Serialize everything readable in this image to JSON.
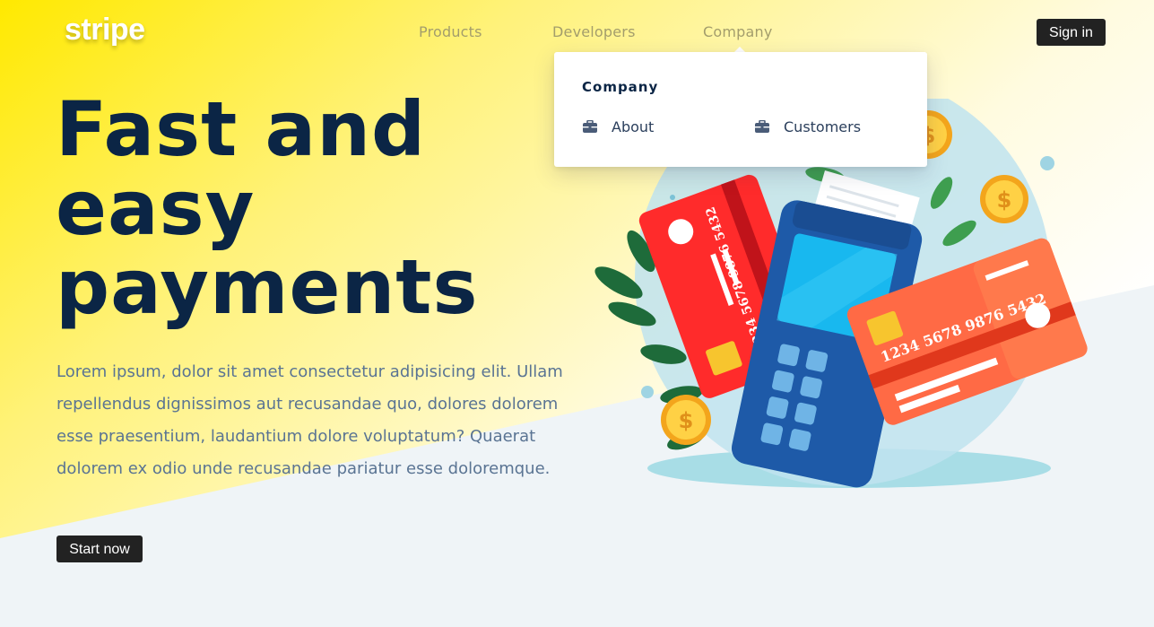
{
  "brand": {
    "logo": "stripe"
  },
  "nav": {
    "items": [
      {
        "label": "Products"
      },
      {
        "label": "Developers"
      },
      {
        "label": "Company"
      }
    ],
    "sign_in": "Sign in"
  },
  "dropdown": {
    "title": "Company",
    "items": [
      {
        "label": "About",
        "icon": "briefcase-icon"
      },
      {
        "label": "Customers",
        "icon": "briefcase-icon"
      }
    ]
  },
  "hero": {
    "title_lines": [
      "Fast and",
      "easy",
      "payments"
    ],
    "text": "Lorem ipsum, dolor sit amet consectetur adipisicing elit. Ullam repellendus dignissimos aut recusandae quo, dolores dolorem esse praesentium, laudantium dolore voluptatum? Quaerat dolorem ex odio unde recusandae pariatur esse doloremque.",
    "cta": "Start now"
  },
  "illustration": {
    "card_number": "1234 5678 9876 5432",
    "coin_symbol": "$"
  },
  "colors": {
    "yellow": "#ffe900",
    "navy": "#0b2545",
    "button": "#222222",
    "card_red": "#ff2b2b",
    "card_orange": "#ff6a45",
    "terminal_blue": "#1e5aa8"
  }
}
